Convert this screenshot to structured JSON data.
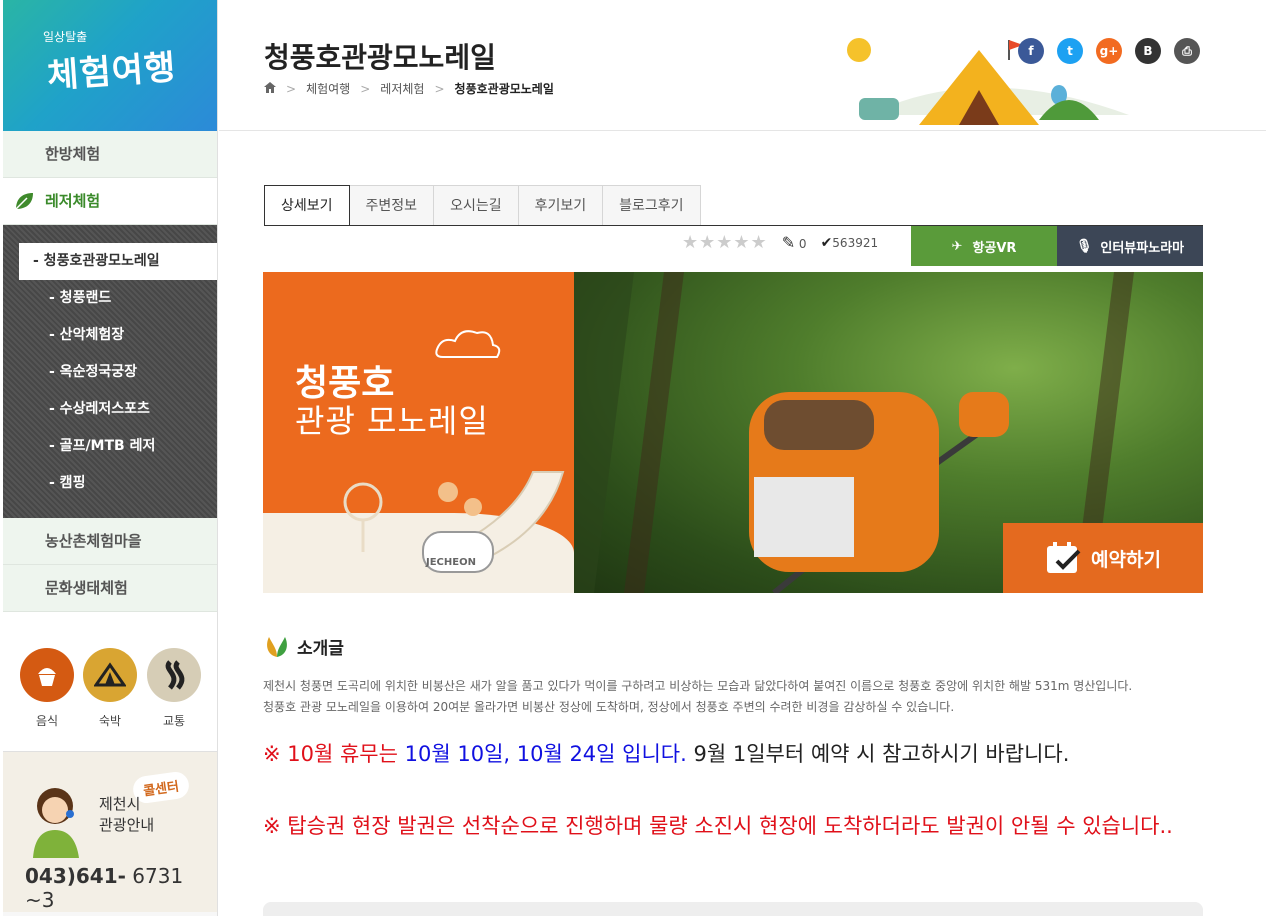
{
  "logo": {
    "sub": "일상탈출",
    "main": "체험여행"
  },
  "sidebar": {
    "items_top": [
      {
        "label": "한방체험"
      }
    ],
    "active_item": {
      "label": "레저체험"
    },
    "submenu": [
      {
        "label": "- 청풍호관광모노레일",
        "current": true
      },
      {
        "label": "- 청풍랜드"
      },
      {
        "label": "- 산악체험장"
      },
      {
        "label": "- 옥순정국궁장"
      },
      {
        "label": "- 수상레저스포츠"
      },
      {
        "label": "- 골프/MTB 레저"
      },
      {
        "label": "- 캠핑"
      }
    ],
    "items_bottom": [
      {
        "label": "농산촌체험마을"
      },
      {
        "label": "문화생태체험"
      }
    ],
    "quick_links": [
      {
        "label": "음식",
        "icon": "cupcake-icon",
        "color": "#d45a12"
      },
      {
        "label": "숙박",
        "icon": "tent-icon",
        "color": "#d9a532"
      },
      {
        "label": "교통",
        "icon": "road-icon",
        "color": "#d6cdb6"
      }
    ],
    "callcenter": {
      "bubble": "콜센터",
      "title_line1": "제천시",
      "title_line2": "관광안내",
      "number_bold": "043)641-",
      "number_rest": " 6731 ~3"
    }
  },
  "header": {
    "title": "청풍호관광모노레일",
    "breadcrumb": [
      "체험여행",
      "레저체험",
      "청풍호관광모노레일"
    ],
    "social": [
      {
        "name": "facebook-icon",
        "glyph": "f",
        "color": "#3b5998"
      },
      {
        "name": "twitter-icon",
        "glyph": "t",
        "color": "#1da1f2"
      },
      {
        "name": "googleplus-icon",
        "glyph": "g+",
        "color": "#f26b21"
      },
      {
        "name": "blog-icon",
        "glyph": "B",
        "color": "#333333"
      },
      {
        "name": "print-icon",
        "glyph": "⎙",
        "color": "#555555"
      }
    ]
  },
  "tabs": [
    "상세보기",
    "주변정보",
    "오시는길",
    "후기보기",
    "블로그후기"
  ],
  "rating": {
    "review_count": "0",
    "views": "563921"
  },
  "buttons": {
    "vr": "항공VR",
    "panorama": "인터뷰파노라마",
    "reserve": "예약하기"
  },
  "hero": {
    "line1": "청풍호",
    "line2": "관광 모노레일",
    "badge": "JECHEON"
  },
  "intro": {
    "title": "소개글",
    "p1": "제천시 청풍면 도곡리에 위치한 비봉산은 새가 알을 품고 있다가 먹이를 구하려고 비상하는 모습과 닮았다하여 붙여진 이름으로 청풍호 중앙에 위치한 해발 531m 명산입니다.",
    "p2": "청풍호 관광 모노레일을 이용하여 20여분 올라가면 비봉산 정상에 도착하며, 정상에서 청풍호 주변의 수려한 비경을 감상하실 수 있습니다.",
    "notice1_red": "※ 10월 휴무는 ",
    "notice1_blue": "10월 10일, 10월 24일 입니다.",
    "notice1_black": " 9월 1일부터 예약 시 참고하시기 바랍니다.",
    "notice2": "※ 탑승권 현장 발권은 선착순으로 진행하며 물량 소진시 현장에 도착하더라도 발권이 안될 수 있습니다.."
  }
}
